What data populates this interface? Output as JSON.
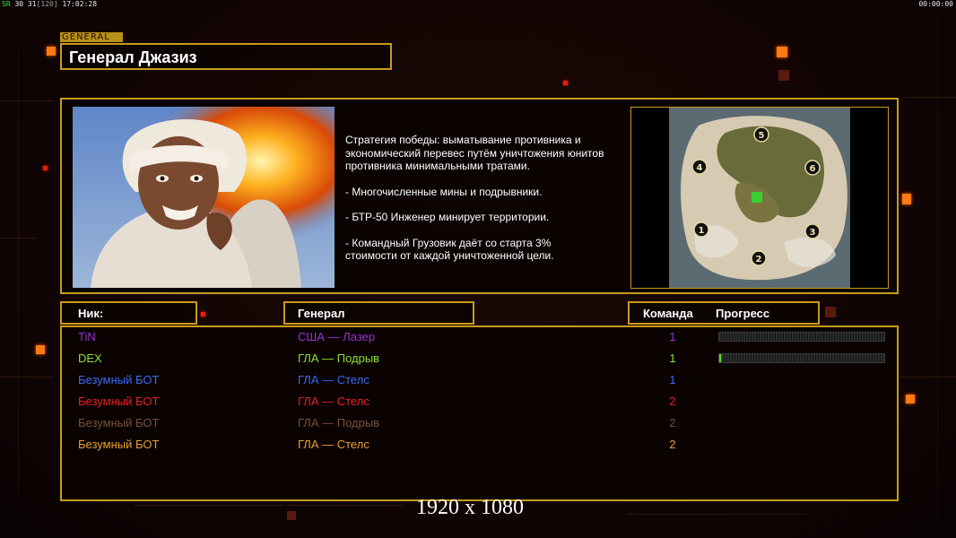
{
  "hud": {
    "sr_label": "SR",
    "left_values": "30 31",
    "left_bracket": "[120]",
    "clock_left": "17:02:28",
    "clock_right": "00:00:00"
  },
  "general": {
    "tag": "GENERAL",
    "name": "Генерал Джазиз"
  },
  "description": [
    "Стратегия победы: выматывание противника и\n экономический перевес путём уничтожения юнитов\n противника минимальными тратами.",
    "- Многочисленные мины и подрывники.",
    "- БТР-50 Инженер минирует территории.",
    "- Командный Грузовик даёт со старта 3%\n стоимости от каждой уничтоженной цели."
  ],
  "icons": {
    "portrait": "general-portrait-image",
    "minimap": "map-preview-image"
  },
  "minimap": {
    "start_positions": [
      "1",
      "2",
      "3",
      "4",
      "5",
      "6"
    ]
  },
  "table": {
    "headers": {
      "nick": "Ник:",
      "general": "Генерал",
      "team": "Команда",
      "progress": "Прогресс"
    },
    "rows": [
      {
        "nick": "TiN",
        "general": "США — Лазер",
        "team": "1",
        "color": "#9b2fd8",
        "progress": 0.0
      },
      {
        "nick": "DEX",
        "general": "ГЛА — Подрыв",
        "team": "1",
        "color": "#8ee03a",
        "progress": 0.01
      },
      {
        "nick": "Безумный БОТ",
        "general": "ГЛА — Стелс",
        "team": "1",
        "color": "#3a6af0",
        "progress": null
      },
      {
        "nick": "Безумный БОТ",
        "general": "ГЛА — Стелс",
        "team": "2",
        "color": "#e82020",
        "progress": null
      },
      {
        "nick": "Безумный БОТ",
        "general": "ГЛА — Подрыв",
        "team": "2",
        "color": "#7a5038",
        "progress": null
      },
      {
        "nick": "Безумный БОТ",
        "general": "ГЛА — Стелс",
        "team": "2",
        "color": "#e8a030",
        "progress": null
      }
    ]
  },
  "resolution": "1920 x 1080",
  "colors": {
    "frame": "#c99a1c",
    "accent": "#ff7a12"
  }
}
